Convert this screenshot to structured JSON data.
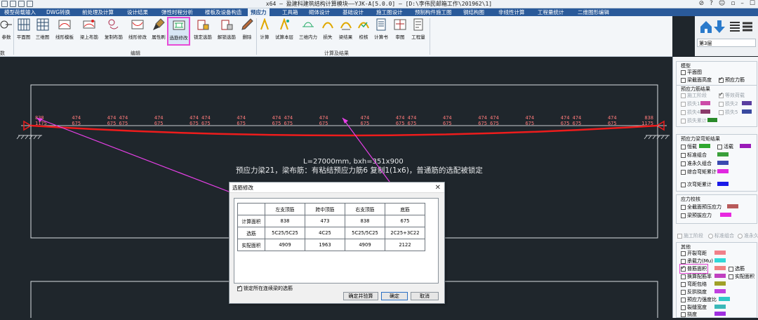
{
  "window": {
    "title": "x64 – 盈建科建筑结构计算模块——YJK-A[5.0.0] – [D:\\李伟民邮箱工作\\201962\\1]",
    "controls": [
      "⊘",
      "?",
      "☺",
      "▫",
      "–",
      "☐"
    ]
  },
  "menu_tabs": [
    "模型荷载输入",
    "DWG转换",
    "前处理及计算",
    "设计结果",
    "弹性时程分析",
    "楼板及设备构造",
    "预应力",
    "工具箱",
    "砌体设计",
    "基础设计",
    "施工图设计",
    "预制构件施工图",
    "钢结构图",
    "非线性计算",
    "工程量统计",
    "二维图形编辑"
  ],
  "active_tab": "预应力",
  "ribbon": {
    "left_cut_label": "参数",
    "left_cut_group": "数",
    "buttons": [
      "平面图",
      "三维图",
      "线形模板",
      "梁上布筋",
      "复制布筋",
      "线形修改",
      "属性刷",
      "选筋修改",
      "锁定选筋",
      "解锁选筋",
      "删除",
      "计算",
      "试算本层",
      "三维内力",
      "损失",
      "梁结果",
      "校核",
      "计算书",
      "审图",
      "工程量"
    ],
    "selected_button": "选筋修改",
    "groups": [
      "编辑",
      "计算及结果"
    ]
  },
  "nav": {
    "floor": "第3层"
  },
  "drawing": {
    "top_labels": [
      "838",
      "474",
      "474 474",
      "474",
      "474 474",
      "474",
      "474 474",
      "474",
      "474",
      "474 474",
      "474",
      "474 474",
      "474",
      "474 474",
      "474",
      "838"
    ],
    "bottom_labels": [
      "1175",
      "675",
      "675 675",
      "675",
      "675 675",
      "675",
      "675 675",
      "675",
      "675",
      "675 675",
      "675",
      "675 675",
      "675",
      "675 675",
      "675",
      "1175"
    ],
    "beam_info": "L=27000mm, bxh=351x900",
    "beam_desc": "预应力梁21，梁布筋：有粘结预应力筋6 复制1(1x6)，普通筋的选配被锁定"
  },
  "dialog": {
    "title": "选筋修改",
    "columns": [
      "",
      "左支顶筋",
      "跨中顶筋",
      "右支顶筋",
      "底筋"
    ],
    "rows": [
      {
        "label": "计算面积",
        "values": [
          "838",
          "473",
          "838",
          "675"
        ]
      },
      {
        "label": "选筋",
        "values": [
          "5C25/5C25",
          "4C25",
          "5C25/5C25",
          "2C25+3C22"
        ]
      },
      {
        "label": "实配面积",
        "values": [
          "4909",
          "1963",
          "4909",
          "2122"
        ]
      }
    ],
    "lock_label": "锁定所在连续梁的选筋",
    "lock_checked": true,
    "buttons": {
      "check": "确定并验算",
      "ok": "确定",
      "cancel": "取消"
    }
  },
  "side": {
    "model_title": "模型",
    "model_items": [
      {
        "label": "平面图",
        "checked": false
      },
      {
        "label": "梁截面高度",
        "checked": false
      },
      {
        "label": "预应力筋",
        "checked": true
      }
    ],
    "loss_title": "预应力筋结果",
    "loss_items": [
      "施工阶段",
      "等效荷载",
      "损失1",
      "损失2",
      "损失4",
      "损失5",
      "损失累计"
    ],
    "force_title": "预应力梁弯矩结果",
    "force_items": [
      "恒载",
      "活载",
      "标准组合",
      "准永久组合",
      "综合弯矩累计",
      "次弯矩累计"
    ],
    "stress_title": "应力校核",
    "stress_items": [
      "全截面预压应力",
      "梁预拔应力"
    ],
    "stage_items": [
      "施工阶段",
      "标准组合",
      "准永久"
    ],
    "other_title": "其他",
    "other_items": [
      "开裂弯距",
      "承载力(Mu)",
      "普筋面积",
      "换算配筋率",
      "弯距包络",
      "反拱挠度",
      "预应力强度比",
      "裂缝宽度",
      "挠度"
    ],
    "highlight_item": "普筋面积",
    "extra_items": [
      "选筋",
      "实配面积"
    ],
    "colors": {
      "loss1": "#cc4aa8",
      "loss2": "#5a3ea0",
      "loss4": "#8a3a6a",
      "loss5": "#3a4aa0",
      "losssum": "#2a8a2a",
      "dead": "#2fa82f",
      "live": "#9a1ab8",
      "std": "#3aa03a",
      "quasi": "#3a4ab0",
      "comb": "#e028e0",
      "sec": "#1a1ae8",
      "s1": "#b85a5a",
      "s2": "#e828e0",
      "o1": "#f0808a",
      "o2": "#30d8d8",
      "o3": "#f08080",
      "o4": "#c040c0",
      "o5": "#a0a028",
      "o6": "#c040e0",
      "o7": "#30c8c8",
      "o8": "#3ab8b8",
      "o9": "#a030e0"
    }
  }
}
